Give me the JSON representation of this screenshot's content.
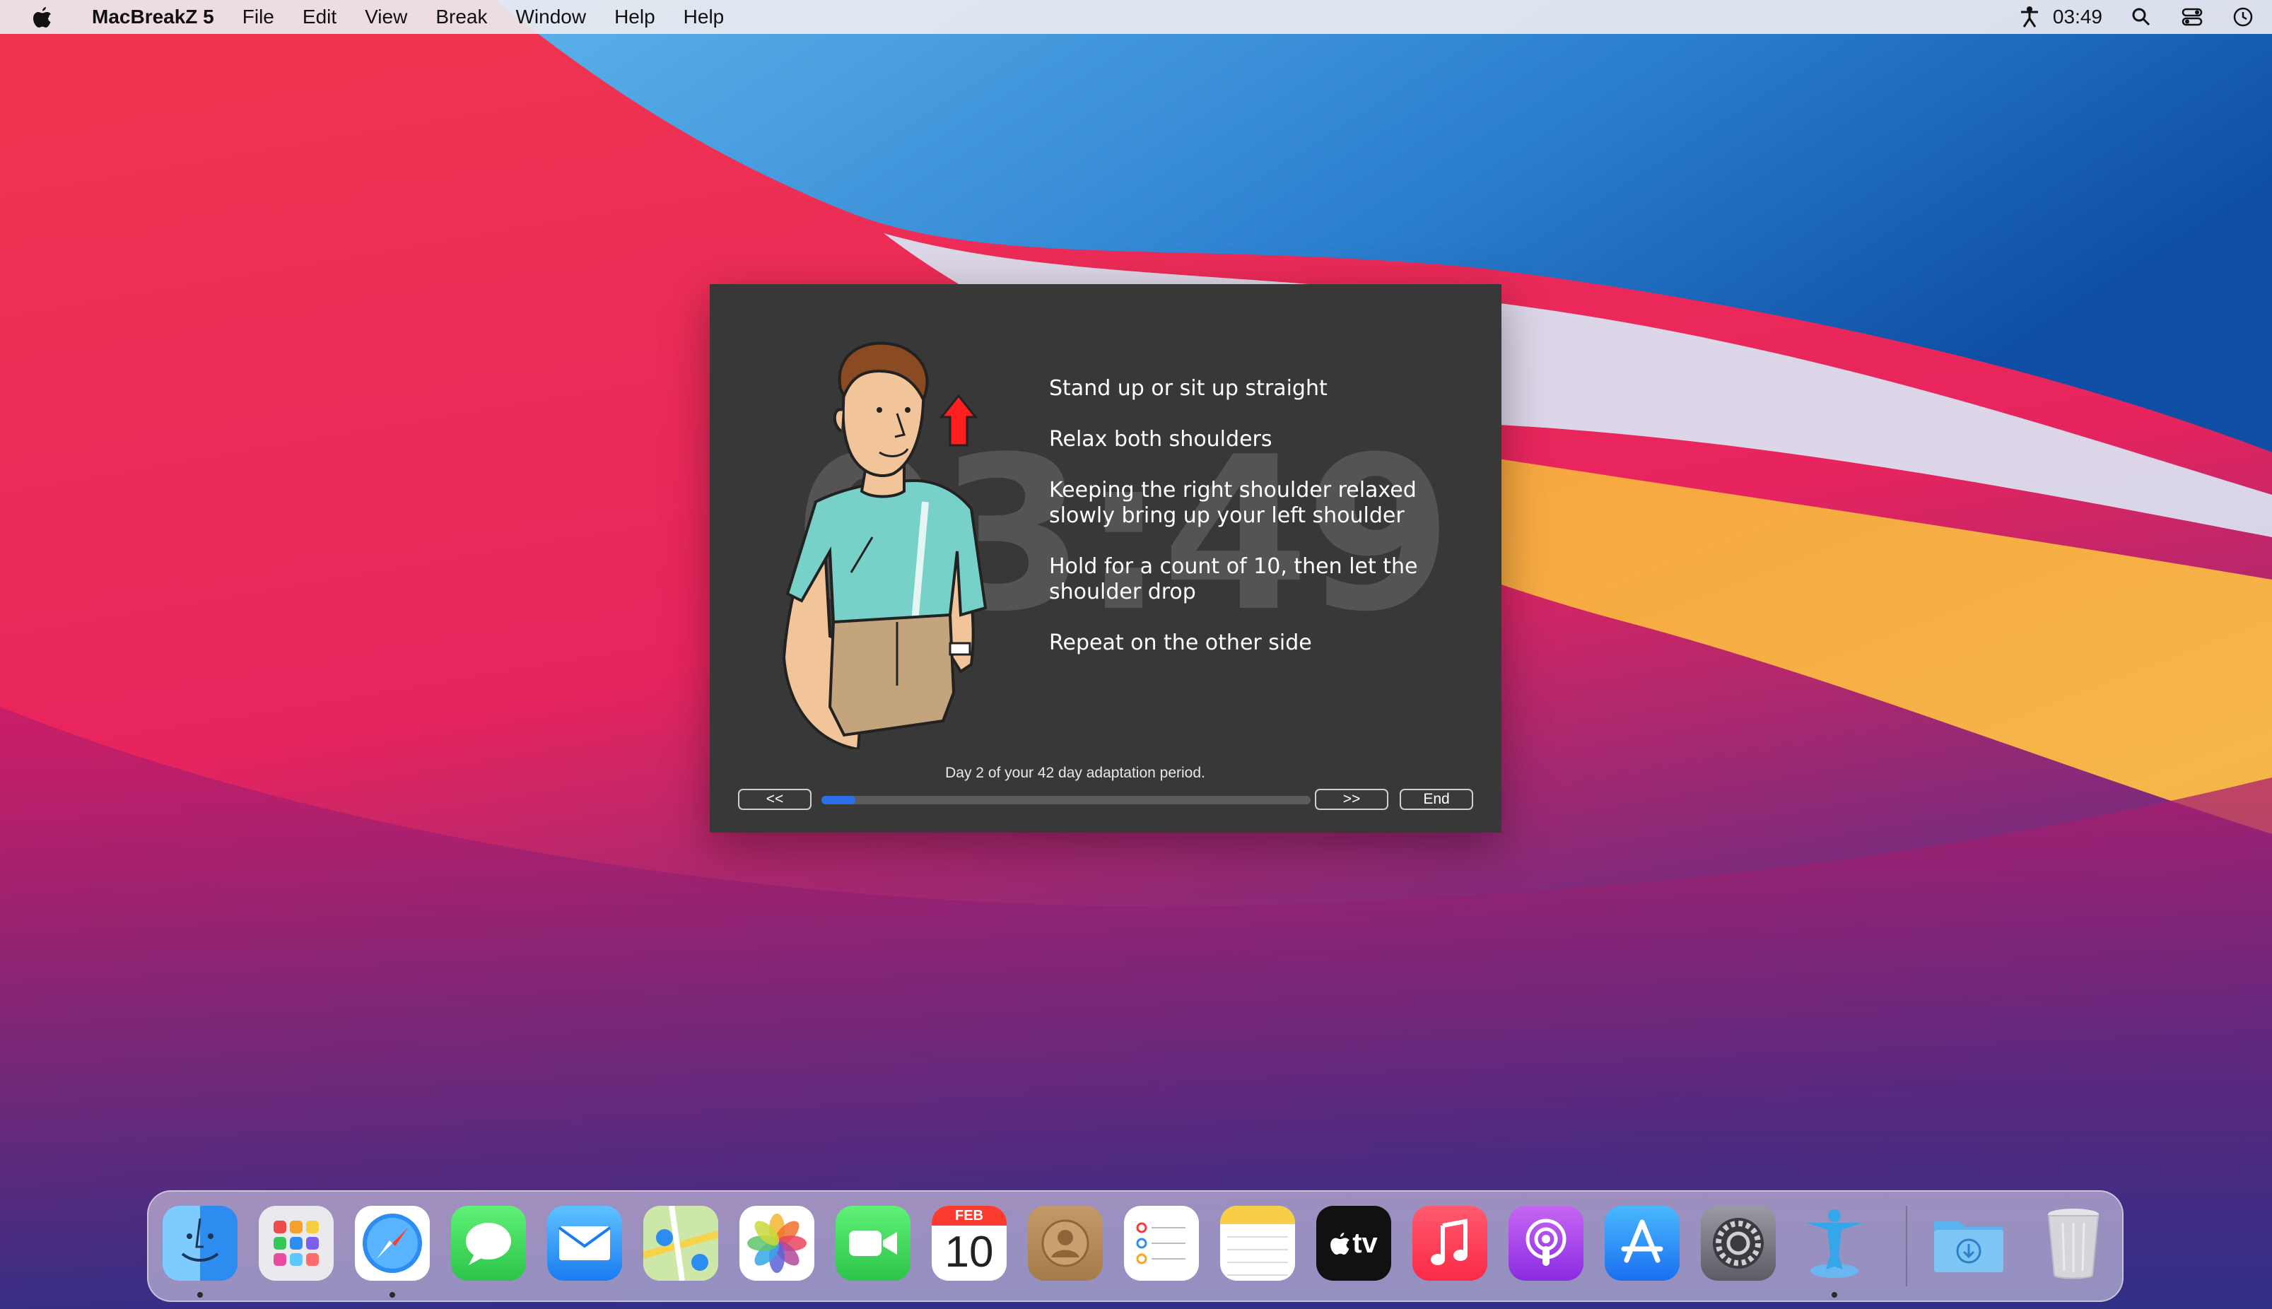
{
  "menubar": {
    "app_name": "MacBreakZ 5",
    "items": [
      "File",
      "Edit",
      "View",
      "Break",
      "Window",
      "Help",
      "Help"
    ],
    "clock": "03:49",
    "icons": [
      "apple-icon",
      "macbreakz-status-icon",
      "search-icon",
      "control-center-icon",
      "clock-icon"
    ]
  },
  "break_window": {
    "timer": "03:49",
    "instructions": [
      "Stand up or sit up straight",
      "Relax both shoulders",
      "Keeping the right shoulder relaxed slowly bring up your left shoulder",
      "Hold for a count of 10, then let the shoulder drop",
      "Repeat on the other side"
    ],
    "status": "Day 2 of your 42 day adaptation period.",
    "prev_label": "<<",
    "next_label": ">>",
    "end_label": "End",
    "progress": 0.07,
    "accent_color": "#2a6fe8"
  },
  "dock": {
    "apps": [
      "Finder",
      "Launchpad",
      "Safari",
      "Messages",
      "Mail",
      "Maps",
      "Photos",
      "FaceTime",
      "Calendar",
      "Contacts",
      "Reminders",
      "Notes",
      "Apple TV",
      "Music",
      "Podcasts",
      "App Store",
      "System Preferences",
      "MacBreakZ"
    ],
    "calendar_month": "FEB",
    "calendar_day": "10",
    "tv_label": "tv",
    "folders": [
      "Downloads",
      "Trash"
    ]
  }
}
